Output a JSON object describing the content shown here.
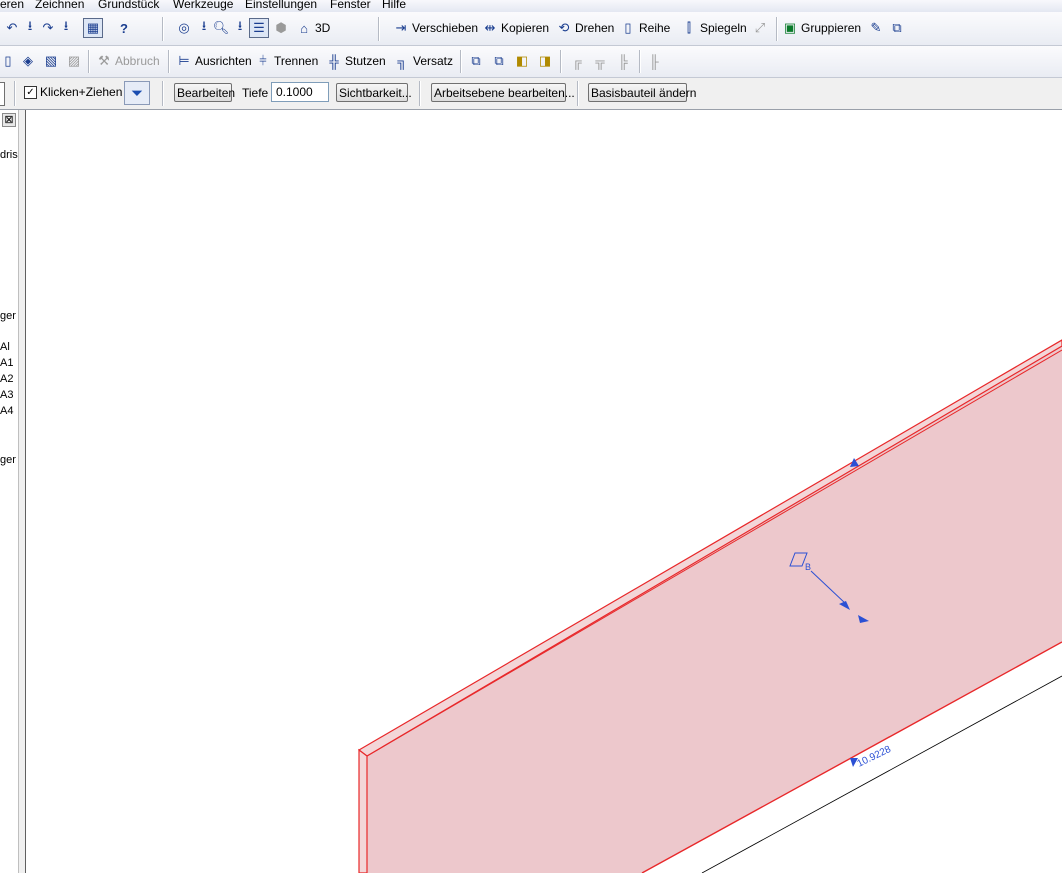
{
  "menu": [
    "eren",
    "Zeichnen",
    "Grundstück",
    "Werkzeuge",
    "Einstellungen",
    "Fenster",
    "Hilfe"
  ],
  "toolbar1": {
    "label_3d": "3D",
    "verschieben": "Verschieben",
    "kopieren": "Kopieren",
    "drehen": "Drehen",
    "reihe": "Reihe",
    "spiegeln": "Spiegeln",
    "gruppieren": "Gruppieren"
  },
  "toolbar2": {
    "abbruch": "Abbruch",
    "ausrichten": "Ausrichten",
    "trennen": "Trennen",
    "stutzen": "Stutzen",
    "versatz": "Versatz"
  },
  "optionsbar": {
    "klicken_ziehen": "Klicken+Ziehen",
    "klicken_ziehen_checked": true,
    "bearbeiten": "Bearbeiten",
    "tiefe_label": "Tiefe",
    "tiefe_value": "0.1000",
    "sichtbarkeit": "Sichtbarkeit...",
    "arbeitsebene": "Arbeitsebene bearbeiten...",
    "basisbauteil": "Basisbauteil ändern"
  },
  "leftpanel": {
    "close": "⊠",
    "lines": [
      "dris",
      "ger",
      "Al",
      "A1",
      "A2",
      "A3",
      "A4",
      "ger"
    ]
  },
  "canvas": {
    "dimension_text": "10.9228",
    "workplane_label": "B",
    "colors": {
      "wall_fill": "#edc8cc",
      "wall_edge": "#e8282a",
      "control": "#2b50d4"
    }
  }
}
